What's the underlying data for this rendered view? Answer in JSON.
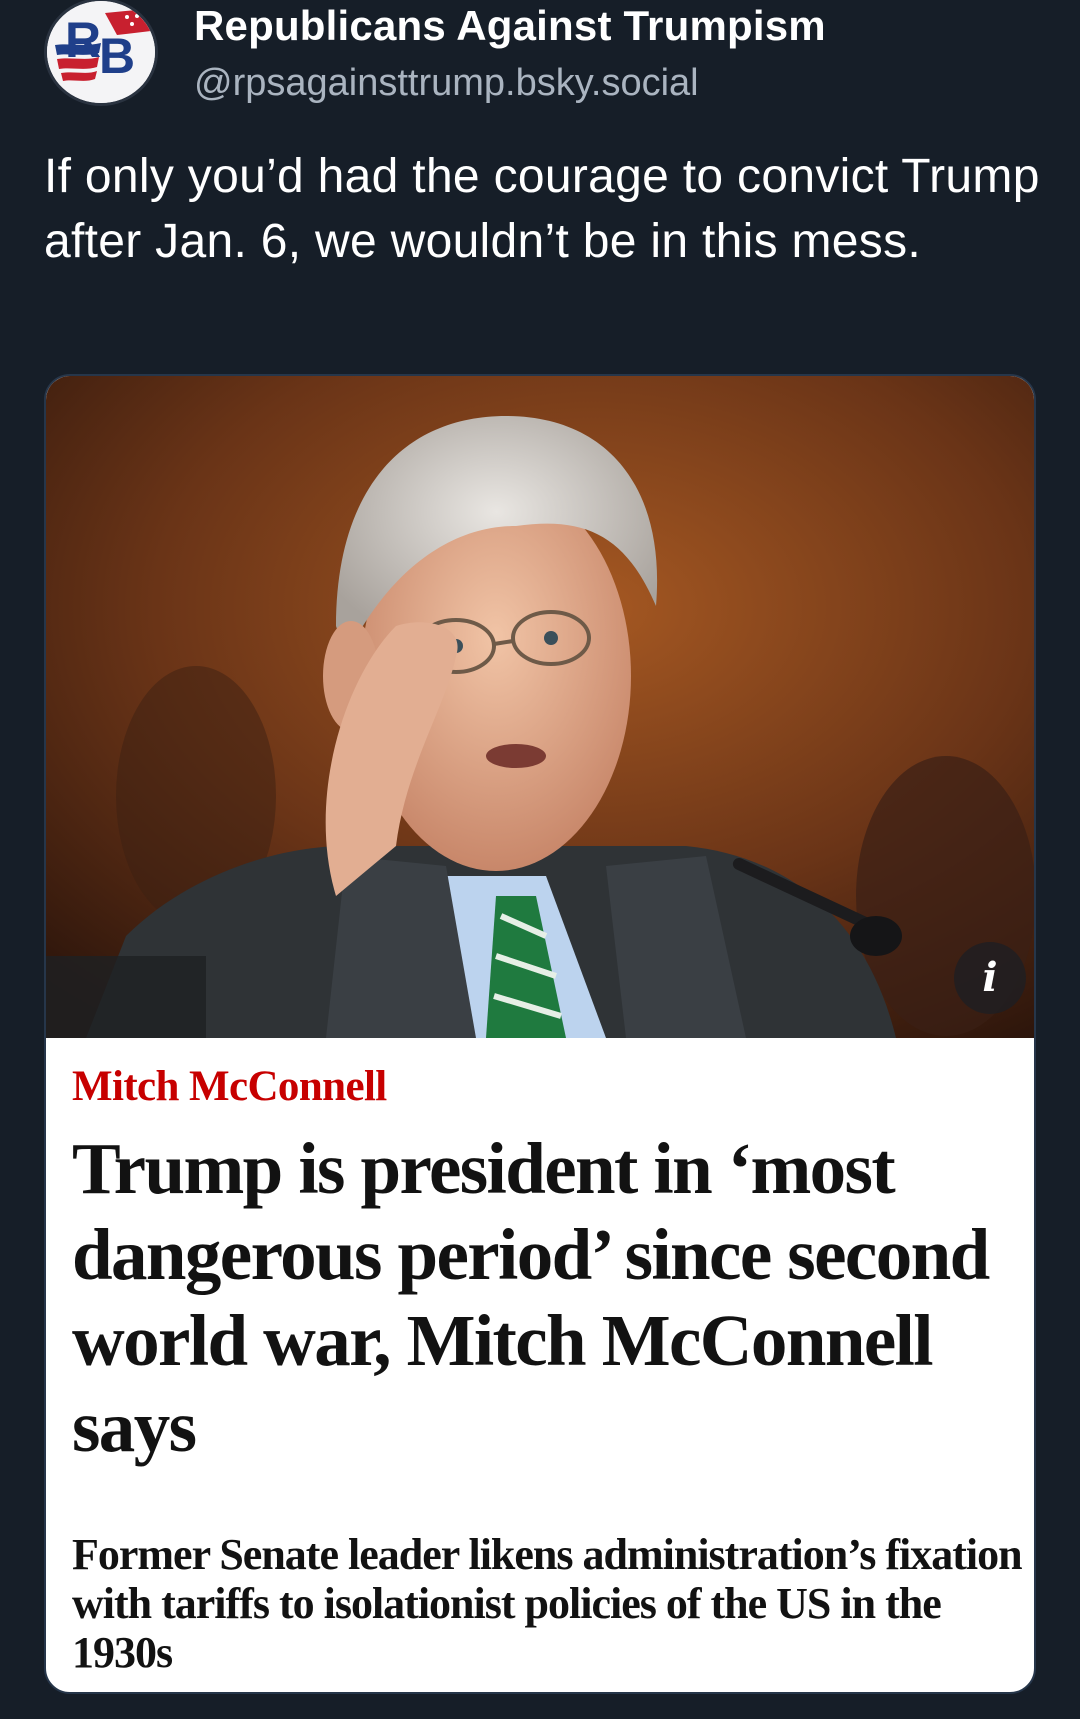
{
  "author": {
    "display_name": "Republicans Against Trumpism",
    "handle": "@rpsagainsttrump.bsky.social",
    "avatar_initials": "RB"
  },
  "post": {
    "text": "If only you’d had the courage to convict Trump after Jan. 6, we wouldn’t be in this mess."
  },
  "embed": {
    "info_icon": "i",
    "kicker": "Mitch McConnell",
    "headline": "Trump is president in ‘most dangerous period’ since second world war, Mitch McConnell says",
    "standfirst": "Former Senate leader likens administration’s fixation with tariffs to isolationist policies of the US in the 1930s"
  },
  "colors": {
    "background": "#161e28",
    "kicker_red": "#c70000",
    "handle_gray": "#aab4c0"
  }
}
